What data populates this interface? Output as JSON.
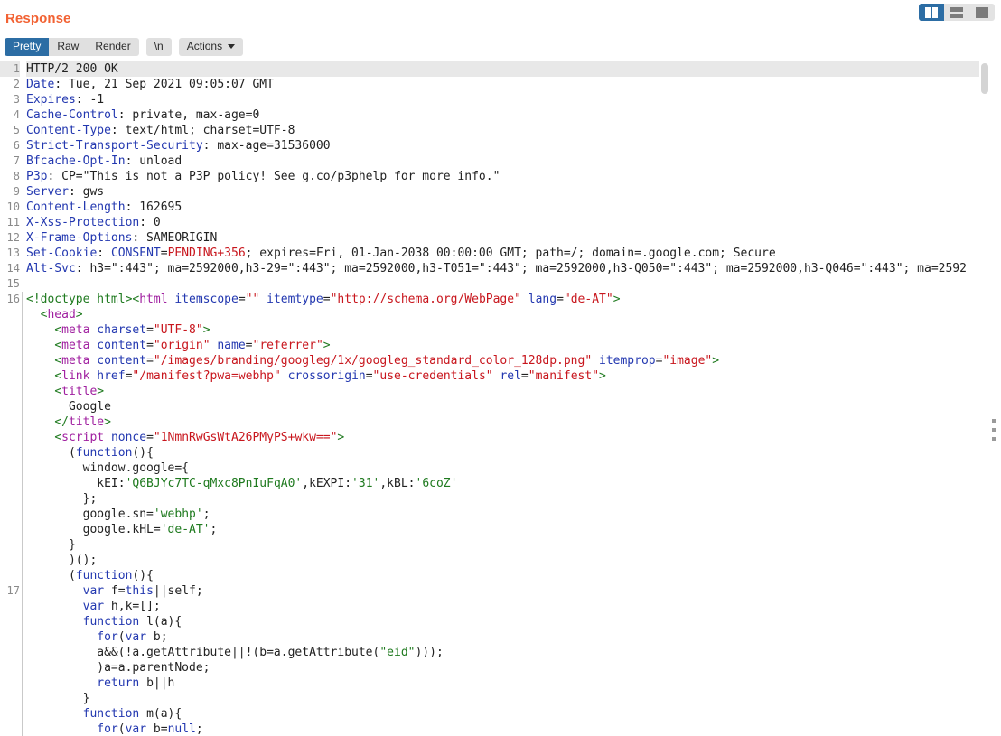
{
  "panel": {
    "title": "Response",
    "layout_buttons": [
      {
        "name": "vertical-split",
        "icon": "vertical-split-icon",
        "active": true
      },
      {
        "name": "horizontal-split",
        "icon": "horizontal-split-icon",
        "active": false
      },
      {
        "name": "single-pane",
        "icon": "single-pane-icon",
        "active": false
      }
    ]
  },
  "toolbar": {
    "view_modes": [
      {
        "label": "Pretty",
        "active": true
      },
      {
        "label": "Raw",
        "active": false
      },
      {
        "label": "Render",
        "active": false
      }
    ],
    "newline_label": "\\n",
    "actions_label": "Actions",
    "actions_caret": "chevron-down-icon"
  },
  "editor": {
    "accent_color": "#f26233",
    "selected_color": "#2c6da4",
    "highlighted_line": 1,
    "lines": [
      {
        "n": "1",
        "highlight": true,
        "body": false,
        "parts": [
          {
            "t": "HTTP/2 200 OK",
            "c": "hv"
          }
        ]
      },
      {
        "n": "2",
        "body": false,
        "parts": [
          {
            "t": "Date",
            "c": "hk"
          },
          {
            "t": ": Tue, 21 Sep 2021 09:05:07 GMT",
            "c": "hv"
          }
        ]
      },
      {
        "n": "3",
        "body": false,
        "parts": [
          {
            "t": "Expires",
            "c": "hk"
          },
          {
            "t": ": -1",
            "c": "hv"
          }
        ]
      },
      {
        "n": "4",
        "body": false,
        "parts": [
          {
            "t": "Cache-Control",
            "c": "hk"
          },
          {
            "t": ": private, max-age=0",
            "c": "hv"
          }
        ]
      },
      {
        "n": "5",
        "body": false,
        "parts": [
          {
            "t": "Content-Type",
            "c": "hk"
          },
          {
            "t": ": text/html; charset=UTF-8",
            "c": "hv"
          }
        ]
      },
      {
        "n": "6",
        "body": false,
        "parts": [
          {
            "t": "Strict-Transport-Security",
            "c": "hk"
          },
          {
            "t": ": max-age=31536000",
            "c": "hv"
          }
        ]
      },
      {
        "n": "7",
        "body": false,
        "parts": [
          {
            "t": "Bfcache-Opt-In",
            "c": "hk"
          },
          {
            "t": ": unload",
            "c": "hv"
          }
        ]
      },
      {
        "n": "8",
        "body": false,
        "parts": [
          {
            "t": "P3p",
            "c": "hk"
          },
          {
            "t": ": CP=\"This is not a P3P policy! See g.co/p3phelp for more info.\"",
            "c": "hv"
          }
        ]
      },
      {
        "n": "9",
        "body": false,
        "parts": [
          {
            "t": "Server",
            "c": "hk"
          },
          {
            "t": ": gws",
            "c": "hv"
          }
        ]
      },
      {
        "n": "10",
        "body": false,
        "parts": [
          {
            "t": "Content-Length",
            "c": "hk"
          },
          {
            "t": ": 162695",
            "c": "hv"
          }
        ]
      },
      {
        "n": "11",
        "body": false,
        "parts": [
          {
            "t": "X-Xss-Protection",
            "c": "hk"
          },
          {
            "t": ": 0",
            "c": "hv"
          }
        ]
      },
      {
        "n": "12",
        "body": false,
        "parts": [
          {
            "t": "X-Frame-Options",
            "c": "hk"
          },
          {
            "t": ": SAMEORIGIN",
            "c": "hv"
          }
        ]
      },
      {
        "n": "13",
        "body": false,
        "parts": [
          {
            "t": "Set-Cookie",
            "c": "hk"
          },
          {
            "t": ": ",
            "c": "hv"
          },
          {
            "t": "CONSENT",
            "c": "hk"
          },
          {
            "t": "=",
            "c": "hv"
          },
          {
            "t": "PENDING+356",
            "c": "hred"
          },
          {
            "t": "; expires=Fri, 01-Jan-2038 00:00:00 GMT; path=/; domain=.google.com; Secure",
            "c": "hv"
          }
        ]
      },
      {
        "n": "14",
        "body": false,
        "parts": [
          {
            "t": "Alt-Svc",
            "c": "hk"
          },
          {
            "t": ": h3=\":443\"; ma=2592000,h3-29=\":443\"; ma=2592000,h3-T051=\":443\"; ma=2592000,h3-Q050=\":443\"; ma=2592000,h3-Q046=\":443\"; ma=2592",
            "c": "hv"
          }
        ]
      },
      {
        "n": "15",
        "body": false,
        "parts": [
          {
            "t": "",
            "c": "hv"
          }
        ]
      },
      {
        "n": "16",
        "body": true,
        "parts": [
          {
            "t": "<!doctype html>",
            "c": "punc"
          },
          {
            "t": "<",
            "c": "punc"
          },
          {
            "t": "html",
            "c": "tag"
          },
          {
            "t": " ",
            "c": "txt"
          },
          {
            "t": "itemscope",
            "c": "attr"
          },
          {
            "t": "=",
            "c": "txt"
          },
          {
            "t": "\"\"",
            "c": "val"
          },
          {
            "t": " ",
            "c": "txt"
          },
          {
            "t": "itemtype",
            "c": "attr"
          },
          {
            "t": "=",
            "c": "txt"
          },
          {
            "t": "\"http://schema.org/WebPage\"",
            "c": "val"
          },
          {
            "t": " ",
            "c": "txt"
          },
          {
            "t": "lang",
            "c": "attr"
          },
          {
            "t": "=",
            "c": "txt"
          },
          {
            "t": "\"de-AT\"",
            "c": "val"
          },
          {
            "t": ">",
            "c": "punc"
          }
        ]
      },
      {
        "n": "",
        "body": true,
        "parts": [
          {
            "t": "  ",
            "c": "txt"
          },
          {
            "t": "<",
            "c": "punc"
          },
          {
            "t": "head",
            "c": "tag"
          },
          {
            "t": ">",
            "c": "punc"
          }
        ]
      },
      {
        "n": "",
        "body": true,
        "parts": [
          {
            "t": "    ",
            "c": "txt"
          },
          {
            "t": "<",
            "c": "punc"
          },
          {
            "t": "meta",
            "c": "tag"
          },
          {
            "t": " ",
            "c": "txt"
          },
          {
            "t": "charset",
            "c": "attr"
          },
          {
            "t": "=",
            "c": "txt"
          },
          {
            "t": "\"UTF-8\"",
            "c": "val"
          },
          {
            "t": ">",
            "c": "punc"
          }
        ]
      },
      {
        "n": "",
        "body": true,
        "parts": [
          {
            "t": "    ",
            "c": "txt"
          },
          {
            "t": "<",
            "c": "punc"
          },
          {
            "t": "meta",
            "c": "tag"
          },
          {
            "t": " ",
            "c": "txt"
          },
          {
            "t": "content",
            "c": "attr"
          },
          {
            "t": "=",
            "c": "txt"
          },
          {
            "t": "\"origin\"",
            "c": "val"
          },
          {
            "t": " ",
            "c": "txt"
          },
          {
            "t": "name",
            "c": "attr"
          },
          {
            "t": "=",
            "c": "txt"
          },
          {
            "t": "\"referrer\"",
            "c": "val"
          },
          {
            "t": ">",
            "c": "punc"
          }
        ]
      },
      {
        "n": "",
        "body": true,
        "parts": [
          {
            "t": "    ",
            "c": "txt"
          },
          {
            "t": "<",
            "c": "punc"
          },
          {
            "t": "meta",
            "c": "tag"
          },
          {
            "t": " ",
            "c": "txt"
          },
          {
            "t": "content",
            "c": "attr"
          },
          {
            "t": "=",
            "c": "txt"
          },
          {
            "t": "\"/images/branding/googleg/1x/googleg_standard_color_128dp.png\"",
            "c": "val"
          },
          {
            "t": " ",
            "c": "txt"
          },
          {
            "t": "itemprop",
            "c": "attr"
          },
          {
            "t": "=",
            "c": "txt"
          },
          {
            "t": "\"image\"",
            "c": "val"
          },
          {
            "t": ">",
            "c": "punc"
          }
        ]
      },
      {
        "n": "",
        "body": true,
        "parts": [
          {
            "t": "    ",
            "c": "txt"
          },
          {
            "t": "<",
            "c": "punc"
          },
          {
            "t": "link",
            "c": "tag"
          },
          {
            "t": " ",
            "c": "txt"
          },
          {
            "t": "href",
            "c": "attr"
          },
          {
            "t": "=",
            "c": "txt"
          },
          {
            "t": "\"/manifest?pwa=webhp\"",
            "c": "val"
          },
          {
            "t": " ",
            "c": "txt"
          },
          {
            "t": "crossorigin",
            "c": "attr"
          },
          {
            "t": "=",
            "c": "txt"
          },
          {
            "t": "\"use-credentials\"",
            "c": "val"
          },
          {
            "t": " ",
            "c": "txt"
          },
          {
            "t": "rel",
            "c": "attr"
          },
          {
            "t": "=",
            "c": "txt"
          },
          {
            "t": "\"manifest\"",
            "c": "val"
          },
          {
            "t": ">",
            "c": "punc"
          }
        ]
      },
      {
        "n": "",
        "body": true,
        "parts": [
          {
            "t": "    ",
            "c": "txt"
          },
          {
            "t": "<",
            "c": "punc"
          },
          {
            "t": "title",
            "c": "tag"
          },
          {
            "t": ">",
            "c": "punc"
          }
        ]
      },
      {
        "n": "",
        "body": true,
        "parts": [
          {
            "t": "      Google",
            "c": "txt"
          }
        ]
      },
      {
        "n": "",
        "body": true,
        "parts": [
          {
            "t": "    ",
            "c": "txt"
          },
          {
            "t": "</",
            "c": "punc"
          },
          {
            "t": "title",
            "c": "tag"
          },
          {
            "t": ">",
            "c": "punc"
          }
        ]
      },
      {
        "n": "",
        "body": true,
        "parts": [
          {
            "t": "    ",
            "c": "txt"
          },
          {
            "t": "<",
            "c": "punc"
          },
          {
            "t": "script",
            "c": "tag"
          },
          {
            "t": " ",
            "c": "txt"
          },
          {
            "t": "nonce",
            "c": "attr"
          },
          {
            "t": "=",
            "c": "txt"
          },
          {
            "t": "\"1NmnRwGsWtA26PMyPS+wkw==\"",
            "c": "val"
          },
          {
            "t": ">",
            "c": "punc"
          }
        ]
      },
      {
        "n": "",
        "body": true,
        "parts": [
          {
            "t": "      (",
            "c": "txt"
          },
          {
            "t": "function",
            "c": "kw"
          },
          {
            "t": "(){",
            "c": "txt"
          }
        ]
      },
      {
        "n": "",
        "body": true,
        "parts": [
          {
            "t": "        window.google={",
            "c": "txt"
          }
        ]
      },
      {
        "n": "",
        "body": true,
        "parts": [
          {
            "t": "          kEI:",
            "c": "txt"
          },
          {
            "t": "'Q6BJYc7TC-qMxc8PnIuFqA0'",
            "c": "str"
          },
          {
            "t": ",kEXPI:",
            "c": "txt"
          },
          {
            "t": "'31'",
            "c": "str"
          },
          {
            "t": ",kBL:",
            "c": "txt"
          },
          {
            "t": "'6coZ'",
            "c": "str"
          }
        ]
      },
      {
        "n": "",
        "body": true,
        "parts": [
          {
            "t": "        };",
            "c": "txt"
          }
        ]
      },
      {
        "n": "",
        "body": true,
        "parts": [
          {
            "t": "        google.sn=",
            "c": "txt"
          },
          {
            "t": "'webhp'",
            "c": "str"
          },
          {
            "t": ";",
            "c": "txt"
          }
        ]
      },
      {
        "n": "",
        "body": true,
        "parts": [
          {
            "t": "        google.kHL=",
            "c": "txt"
          },
          {
            "t": "'de-AT'",
            "c": "str"
          },
          {
            "t": ";",
            "c": "txt"
          }
        ]
      },
      {
        "n": "",
        "body": true,
        "parts": [
          {
            "t": "      }",
            "c": "txt"
          }
        ]
      },
      {
        "n": "",
        "body": true,
        "parts": [
          {
            "t": "      )();",
            "c": "txt"
          }
        ]
      },
      {
        "n": "",
        "body": true,
        "parts": [
          {
            "t": "      (",
            "c": "txt"
          },
          {
            "t": "function",
            "c": "kw"
          },
          {
            "t": "(){",
            "c": "txt"
          }
        ]
      },
      {
        "n": "17",
        "body": true,
        "parts": [
          {
            "t": "        ",
            "c": "txt"
          },
          {
            "t": "var",
            "c": "kw"
          },
          {
            "t": " f=",
            "c": "txt"
          },
          {
            "t": "this",
            "c": "kw"
          },
          {
            "t": "||self;",
            "c": "txt"
          }
        ]
      },
      {
        "n": "",
        "body": true,
        "parts": [
          {
            "t": "        ",
            "c": "txt"
          },
          {
            "t": "var",
            "c": "kw"
          },
          {
            "t": " h,k=[];",
            "c": "txt"
          }
        ]
      },
      {
        "n": "",
        "body": true,
        "parts": [
          {
            "t": "        ",
            "c": "txt"
          },
          {
            "t": "function",
            "c": "kw"
          },
          {
            "t": " l(a){",
            "c": "txt"
          }
        ]
      },
      {
        "n": "",
        "body": true,
        "parts": [
          {
            "t": "          ",
            "c": "txt"
          },
          {
            "t": "for",
            "c": "kw"
          },
          {
            "t": "(",
            "c": "txt"
          },
          {
            "t": "var",
            "c": "kw"
          },
          {
            "t": " b;",
            "c": "txt"
          }
        ]
      },
      {
        "n": "",
        "body": true,
        "parts": [
          {
            "t": "          a&&(!a.getAttribute||!(b=a.getAttribute(",
            "c": "txt"
          },
          {
            "t": "\"eid\"",
            "c": "str"
          },
          {
            "t": ")));",
            "c": "txt"
          }
        ]
      },
      {
        "n": "",
        "body": true,
        "parts": [
          {
            "t": "          )a=a.parentNode;",
            "c": "txt"
          }
        ]
      },
      {
        "n": "",
        "body": true,
        "parts": [
          {
            "t": "          ",
            "c": "txt"
          },
          {
            "t": "return",
            "c": "kw"
          },
          {
            "t": " b||h",
            "c": "txt"
          }
        ]
      },
      {
        "n": "",
        "body": true,
        "parts": [
          {
            "t": "        }",
            "c": "txt"
          }
        ]
      },
      {
        "n": "",
        "body": true,
        "parts": [
          {
            "t": "        ",
            "c": "txt"
          },
          {
            "t": "function",
            "c": "kw"
          },
          {
            "t": " m(a){",
            "c": "txt"
          }
        ]
      },
      {
        "n": "",
        "body": true,
        "parts": [
          {
            "t": "          ",
            "c": "txt"
          },
          {
            "t": "for",
            "c": "kw"
          },
          {
            "t": "(",
            "c": "txt"
          },
          {
            "t": "var",
            "c": "kw"
          },
          {
            "t": " b=",
            "c": "txt"
          },
          {
            "t": "null",
            "c": "kw"
          },
          {
            "t": ";",
            "c": "txt"
          }
        ]
      }
    ]
  },
  "scrollbar": {
    "orientation": "vertical",
    "thumb_position_percent": 0,
    "thumb_size_percent": 5
  },
  "resize_grip": {
    "icon": "drag-handle-dots-icon"
  }
}
